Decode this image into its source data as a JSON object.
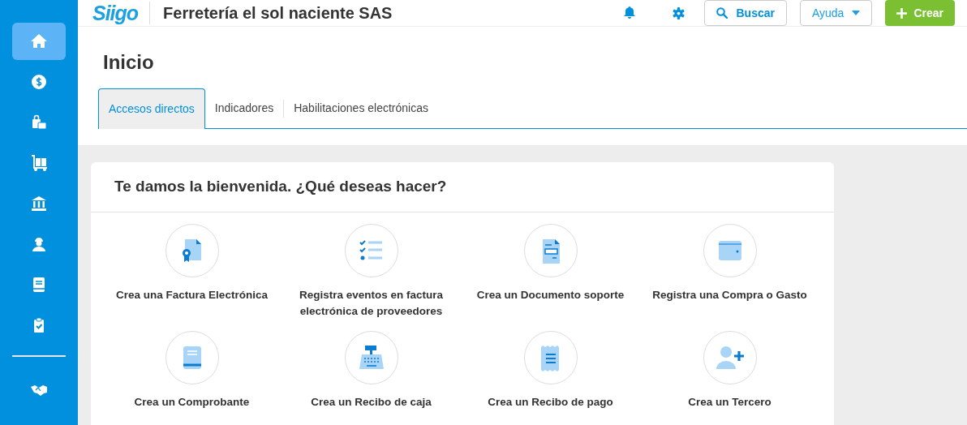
{
  "sidebar": {
    "items": [
      {
        "selected": true
      },
      {
        "selected": false
      },
      {
        "selected": false
      },
      {
        "selected": false
      },
      {
        "selected": false
      },
      {
        "selected": false
      },
      {
        "selected": false
      },
      {
        "selected": false
      },
      {
        "selected": false
      }
    ]
  },
  "header": {
    "logo": "Siigo",
    "company": "Ferretería el sol naciente SAS",
    "search_button": "Buscar",
    "help_button": "Ayuda",
    "create_button": "Crear"
  },
  "page": {
    "title": "Inicio"
  },
  "tabs": [
    {
      "label": "Accesos directos",
      "selected": true
    },
    {
      "label": "Indicadores",
      "selected": false
    },
    {
      "label": "Habilitaciones electrónicas",
      "selected": false
    }
  ],
  "welcome": {
    "title": "Te damos la bienvenida. ¿Qué deseas hacer?",
    "shortcuts": [
      {
        "label": "Crea una Factura Electrónica"
      },
      {
        "label": "Registra eventos en factura electrónica de proveedores"
      },
      {
        "label": "Crea un Documento soporte"
      },
      {
        "label": "Registra una Compra o Gasto"
      },
      {
        "label": "Crea un Comprobante"
      },
      {
        "label": "Crea un Recibo de caja"
      },
      {
        "label": "Crea un Recibo de pago"
      },
      {
        "label": "Crea un Tercero"
      }
    ]
  }
}
